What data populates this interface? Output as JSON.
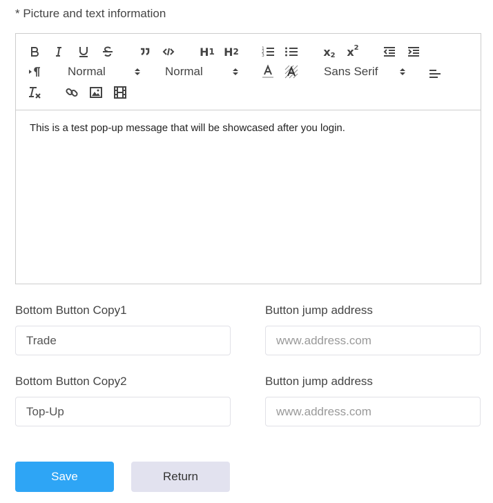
{
  "section": {
    "label": "* Picture and text information"
  },
  "editor": {
    "toolbar": {
      "header_picker": "Normal",
      "size_picker": "Normal",
      "font_picker": "Sans Serif",
      "icons": [
        "bold-icon",
        "italic-icon",
        "underline-icon",
        "strike-icon",
        "blockquote-icon",
        "code-block-icon",
        "h1-icon",
        "h2-icon",
        "ordered-list-icon",
        "bullet-list-icon",
        "subscript-icon",
        "superscript-icon",
        "outdent-icon",
        "indent-icon",
        "rtl-direction-icon",
        "font-color-icon",
        "background-color-icon",
        "align-left-icon",
        "clean-format-icon",
        "link-icon",
        "image-icon",
        "video-icon"
      ]
    },
    "content": "This is a test pop-up message that will be showcased after you login."
  },
  "fields": {
    "copy1": {
      "label": "Bottom Button Copy1",
      "value": "Trade"
    },
    "address1": {
      "label": "Button jump address",
      "placeholder": "www.address.com"
    },
    "copy2": {
      "label": "Bottom Button Copy2",
      "value": "Top-Up"
    },
    "address2": {
      "label": "Button jump address",
      "placeholder": "www.address.com"
    }
  },
  "buttons": {
    "save": "Save",
    "return": "Return"
  },
  "colors": {
    "save": "#2ea5f5",
    "return": "#e2e2ef",
    "border": "#cccccc"
  }
}
